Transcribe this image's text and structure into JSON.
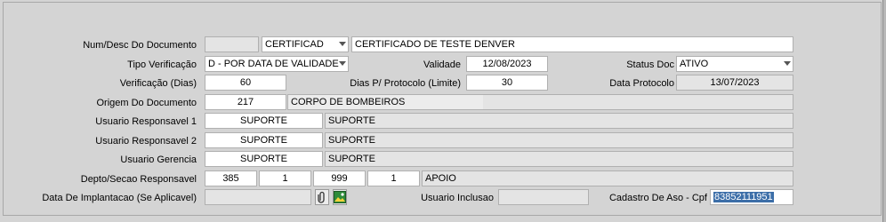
{
  "form": {
    "num_desc": {
      "label": "Num/Desc Do Documento",
      "num": "",
      "type": "CERTIFICAD",
      "desc": "CERTIFICADO DE TESTE DENVER"
    },
    "tipo_verificacao": {
      "label": "Tipo Verificação",
      "value": "D - POR DATA DE VALIDADE"
    },
    "validade": {
      "label": "Validade",
      "value": "12/08/2023"
    },
    "status_doc": {
      "label": "Status Doc",
      "value": "ATIVO"
    },
    "verificacao_dias": {
      "label": "Verificação (Dias)",
      "value": "60"
    },
    "dias_protocolo": {
      "label": "Dias P/ Protocolo (Limite)",
      "value": "30"
    },
    "data_protocolo": {
      "label": "Data Protocolo",
      "value": "13/07/2023"
    },
    "origem": {
      "label": "Origem Do Documento",
      "code": "217",
      "desc": "CORPO DE BOMBEIROS"
    },
    "usuario_resp1": {
      "label": "Usuario Responsavel 1",
      "code": "SUPORTE",
      "name": "SUPORTE"
    },
    "usuario_resp2": {
      "label": "Usuario Responsavel 2",
      "code": "SUPORTE",
      "name": "SUPORTE"
    },
    "usuario_gerencia": {
      "label": "Usuario Gerencia",
      "code": "SUPORTE",
      "name": "SUPORTE"
    },
    "depto": {
      "label": "Depto/Secao Responsavel",
      "v1": "385",
      "v2": "1",
      "v3": "999",
      "v4": "1",
      "desc": "APOIO"
    },
    "data_implantacao": {
      "label": "Data De Implantacao (Se Aplicavel)",
      "value": ""
    },
    "usuario_inclusao": {
      "label": "Usuario Inclusao",
      "value": ""
    },
    "cadastro_aso": {
      "label": "Cadastro De Aso - Cpf",
      "value": "83852111951"
    }
  },
  "icons": {
    "attach": "paperclip-icon",
    "image": "image-icon"
  },
  "colors": {
    "selection": "#3c6ea8",
    "readonly": "#e4e4e4",
    "background": "#d4d4d4"
  }
}
